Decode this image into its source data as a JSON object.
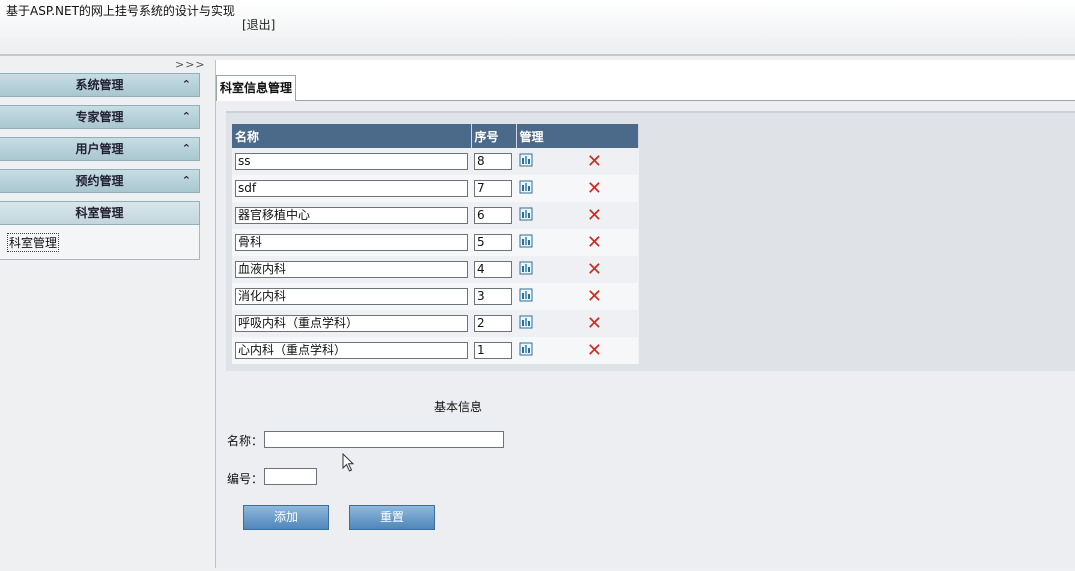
{
  "app": {
    "title": "基于ASP.NET的网上挂号系统的设计与实现",
    "logout_label": "[退出]"
  },
  "sidebar": {
    "collapse_label": ">>>",
    "items": [
      {
        "label": "系统管理",
        "icon": "chevron-up-icon"
      },
      {
        "label": "专家管理",
        "icon": "chevron-up-icon"
      },
      {
        "label": "用户管理",
        "icon": "chevron-up-icon"
      },
      {
        "label": "预约管理",
        "icon": "chevron-up-icon"
      },
      {
        "label": "科室管理"
      }
    ],
    "sub_items": [
      {
        "label": "科室管理"
      }
    ]
  },
  "main": {
    "tab_label": "科室信息管理",
    "table": {
      "columns": [
        "名称",
        "序号",
        "管理"
      ],
      "rows": [
        {
          "name": "ss",
          "order": "8"
        },
        {
          "name": "sdf",
          "order": "7"
        },
        {
          "name": "器官移植中心",
          "order": "6"
        },
        {
          "name": "骨科",
          "order": "5"
        },
        {
          "name": "血液内科",
          "order": "4"
        },
        {
          "name": "消化内科",
          "order": "3"
        },
        {
          "name": "呼吸内科（重点学科）",
          "order": "2"
        },
        {
          "name": "心内科（重点学科）",
          "order": "1"
        }
      ]
    },
    "form": {
      "title": "基本信息",
      "name_label": "名称：",
      "name_value": "",
      "number_label": "编号：",
      "number_value": "",
      "add_label": "添加",
      "reset_label": "重置"
    }
  },
  "colors": {
    "menu": "#a9c7cf",
    "table_header": "#4b6a8a",
    "button": "#4f86ba",
    "delete": "#cc2a1f"
  }
}
